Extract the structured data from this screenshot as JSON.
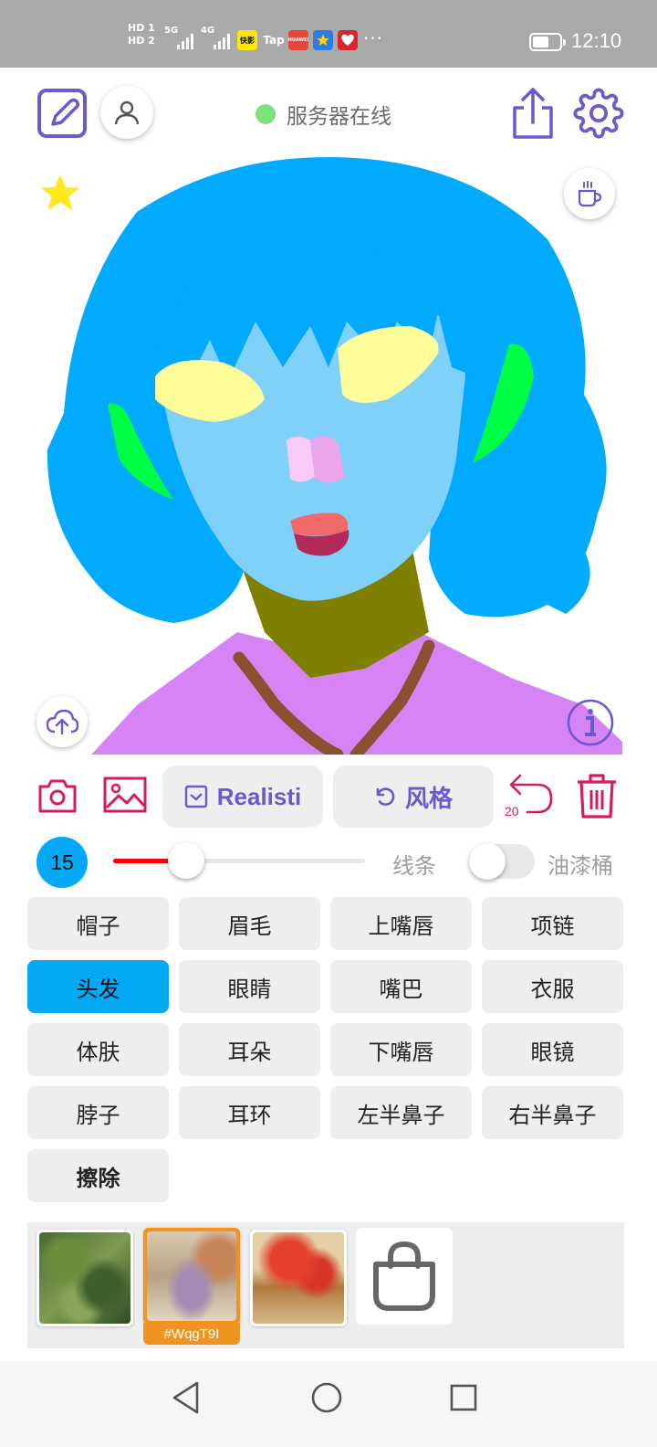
{
  "status_bar": {
    "hd_top": "HD 1",
    "hd_bottom": "HD 2",
    "net1": "5G",
    "net2": "4G",
    "app1": "快影",
    "app2": "Tap",
    "app3": "HUAWEI",
    "more": "···",
    "battery_level": 0.6,
    "time": "12:10"
  },
  "toolbar": {
    "server_status": "服务器在线",
    "server_status_color": "#7fe07f",
    "accent": "#6a5acd",
    "danger": "#d81b60"
  },
  "actions": {
    "model_label": "Realisti",
    "style_label": "风格",
    "undo_count": "20"
  },
  "brush": {
    "size": "15",
    "size_fraction": 0.29,
    "line_label": "线条",
    "bucket_label": "油漆桶",
    "bucket_enabled": false
  },
  "parts": [
    {
      "label": "帽子",
      "selected": false
    },
    {
      "label": "眉毛",
      "selected": false
    },
    {
      "label": "上嘴唇",
      "selected": false
    },
    {
      "label": "项链",
      "selected": false
    },
    {
      "label": "头发",
      "selected": true
    },
    {
      "label": "眼睛",
      "selected": false
    },
    {
      "label": "嘴巴",
      "selected": false
    },
    {
      "label": "衣服",
      "selected": false
    },
    {
      "label": "体肤",
      "selected": false
    },
    {
      "label": "耳朵",
      "selected": false
    },
    {
      "label": "下嘴唇",
      "selected": false
    },
    {
      "label": "眼镜",
      "selected": false
    },
    {
      "label": "脖子",
      "selected": false
    },
    {
      "label": "耳环",
      "selected": false
    },
    {
      "label": "左半鼻子",
      "selected": false
    },
    {
      "label": "右半鼻子",
      "selected": false
    },
    {
      "label": "擦除",
      "selected": false,
      "bold": true
    }
  ],
  "styles": {
    "selected_code": "#WqgT9I"
  },
  "colors": {
    "hair": "#00aaff",
    "skin": "#7fd1f9",
    "eyes": "#fdfd99",
    "ears": "#00ff44",
    "neck": "#808000",
    "clothes": "#d683f6",
    "necklace": "#8b5030",
    "nose_left": "#f9c9f7",
    "nose_right": "#eca4ea",
    "upper_lip": "#f06a6a",
    "lower_lip": "#b22a58",
    "selected_part": "#03a9f4",
    "slider": "#ff0000",
    "star": "#ffe81c"
  }
}
